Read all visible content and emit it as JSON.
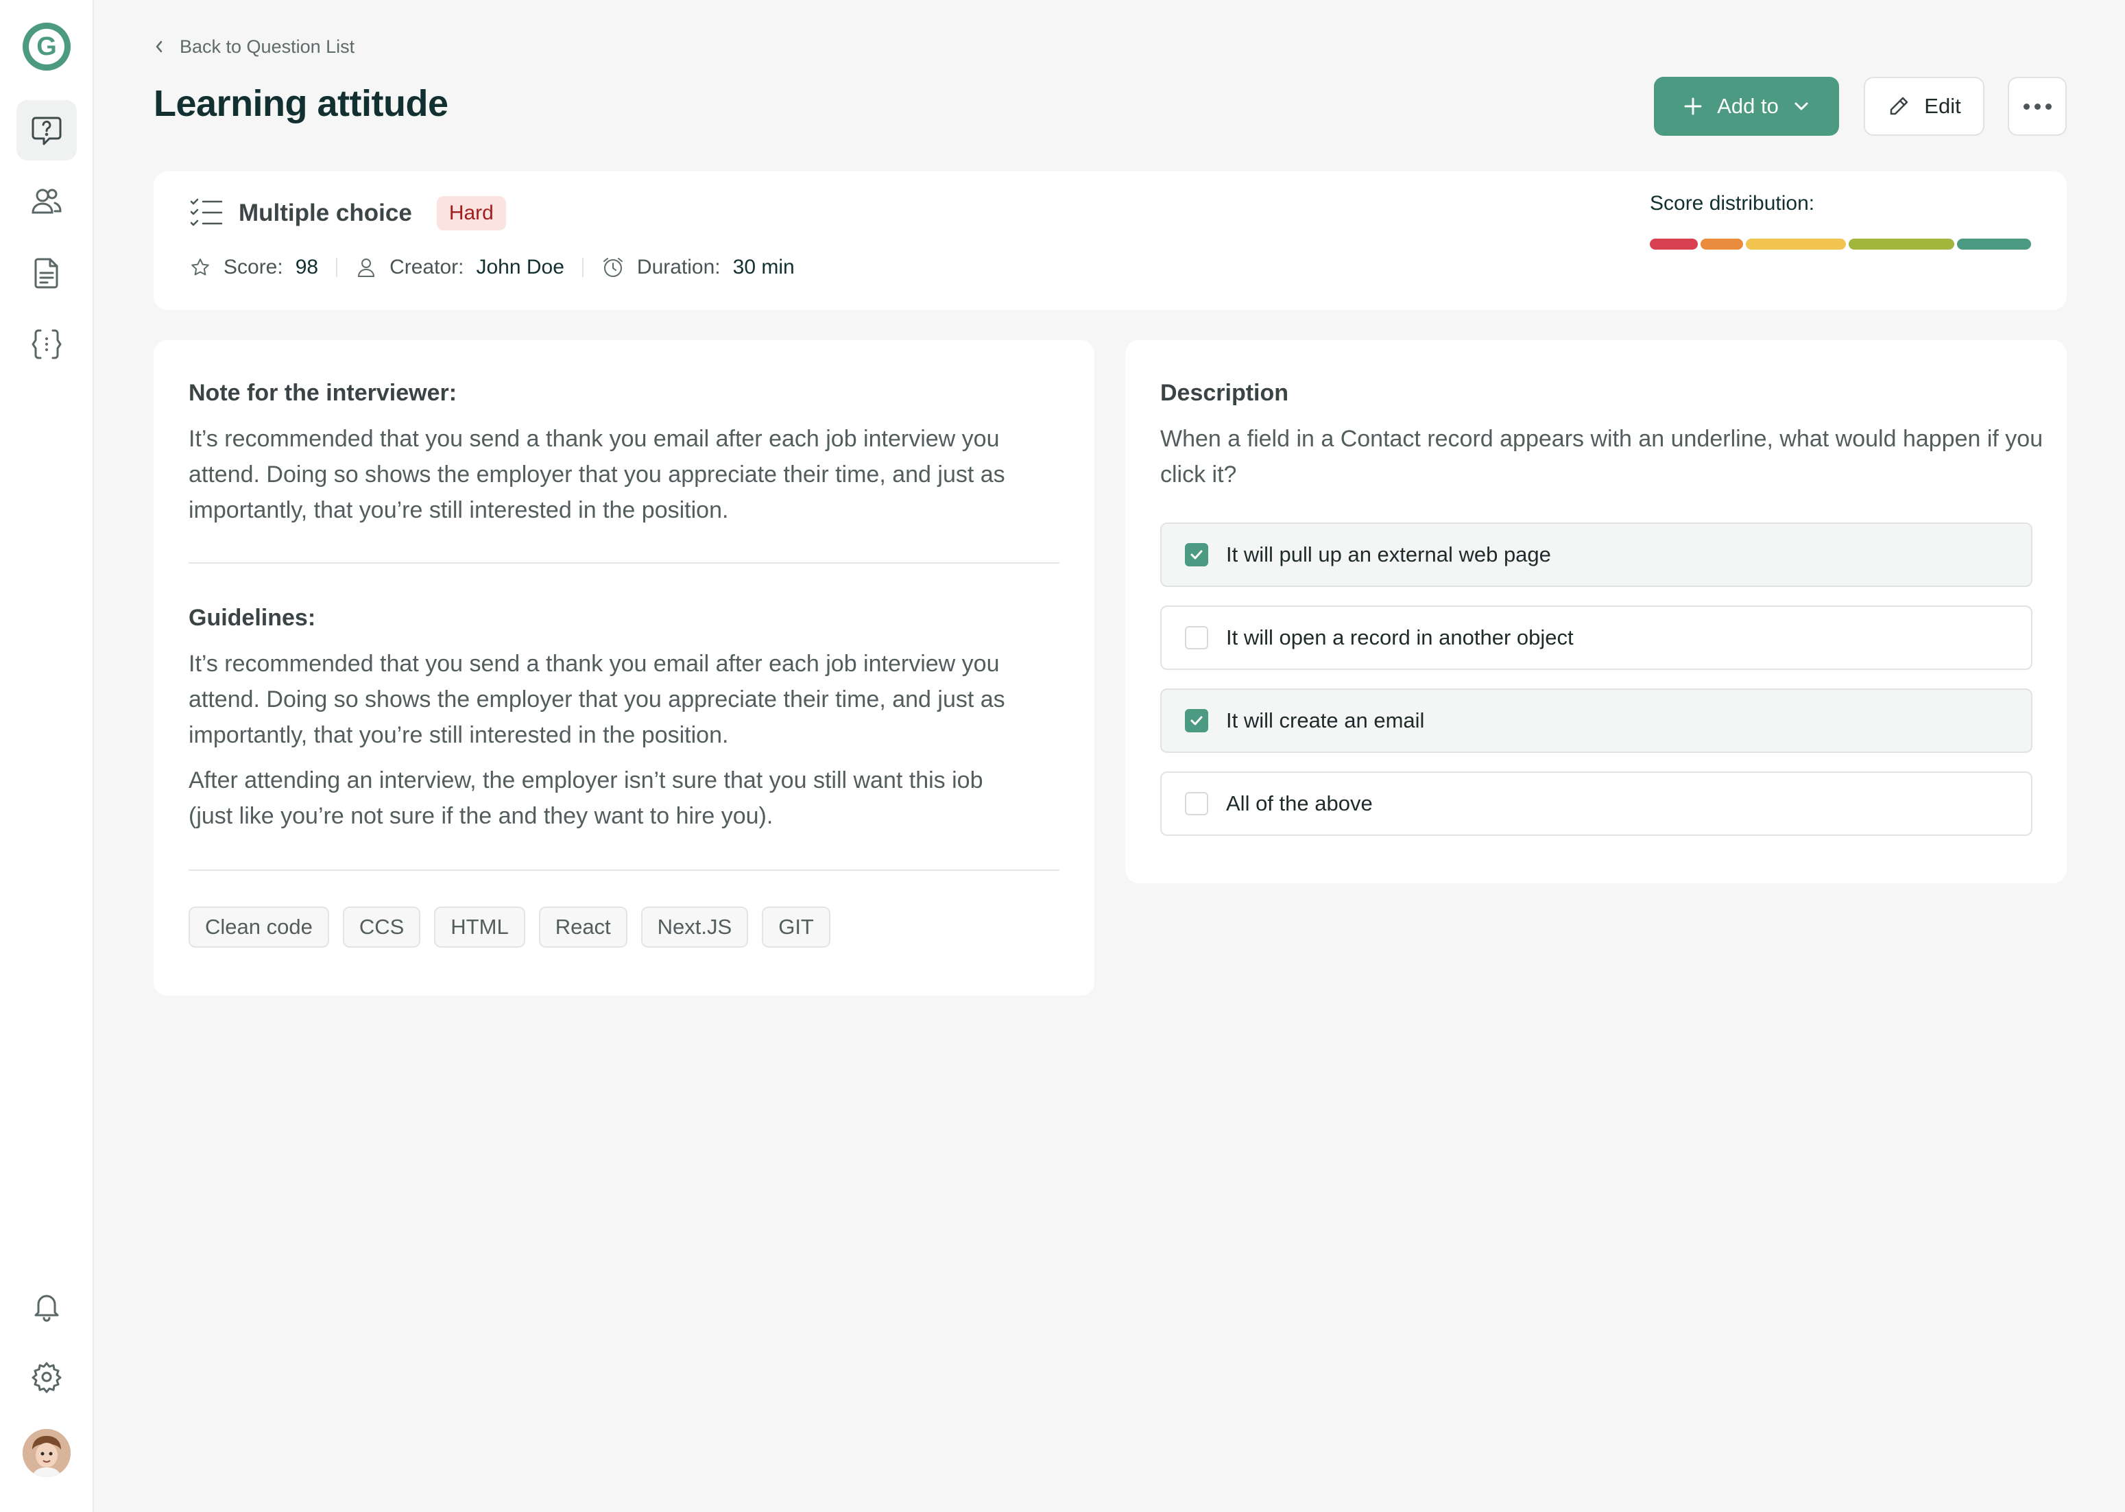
{
  "brand": {
    "logo_letter": "G",
    "accent": "#4c9a82"
  },
  "sidebar": {
    "items": [
      {
        "name": "questions",
        "icon": "question-chat-icon",
        "active": true
      },
      {
        "name": "candidates",
        "icon": "users-icon",
        "active": false
      },
      {
        "name": "documents",
        "icon": "document-icon",
        "active": false
      },
      {
        "name": "code",
        "icon": "code-braces-icon",
        "active": false
      }
    ],
    "bottom": [
      {
        "name": "notifications",
        "icon": "bell-icon"
      },
      {
        "name": "settings",
        "icon": "gear-icon"
      },
      {
        "name": "profile",
        "icon": "avatar"
      }
    ]
  },
  "header": {
    "back_label": "Back to Question List",
    "title": "Learning attitude",
    "add_label": "Add to",
    "edit_label": "Edit"
  },
  "info": {
    "type_label": "Multiple choice",
    "difficulty": "Hard",
    "score_label": "Score:",
    "score_value": "98",
    "creator_label": "Creator:",
    "creator_value": "John Doe",
    "duration_label": "Duration:",
    "duration_value": "30 min",
    "score_distribution_label": "Score distribution:",
    "score_distribution_colors": [
      "#d8404f",
      "#e98c3e",
      "#f3c550",
      "#a2b53c",
      "#4c9a82"
    ]
  },
  "notes": {
    "interviewer_heading": "Note for the interviewer:",
    "interviewer_text": "It’s recommended that you send a thank you email after each job interview you attend. Doing so shows the employer that you appreciate their time, and just as importantly, that you’re still interested in the position.",
    "guidelines_heading": "Guidelines:",
    "guidelines_text_1": "It’s recommended that you send a thank you email after each job interview you attend. Doing so shows the employer that you appreciate their time, and just as importantly, that you’re still interested in the position.",
    "guidelines_text_2": "After attending an interview, the employer isn’t sure that you still want this iob (just like you’re not sure if the and they want to hire you).",
    "tags": [
      "Clean code",
      "CCS",
      "HTML",
      "React",
      "Next.JS",
      "GIT"
    ]
  },
  "description": {
    "heading": "Description",
    "text": "When a field in a Contact record appears with an underline, what would happen if you click it?",
    "options": [
      {
        "label": "It will pull up an external web page",
        "checked": true
      },
      {
        "label": "It will open a record in another object",
        "checked": false
      },
      {
        "label": "It will create an email",
        "checked": true
      },
      {
        "label": "All of the above",
        "checked": false
      }
    ]
  }
}
